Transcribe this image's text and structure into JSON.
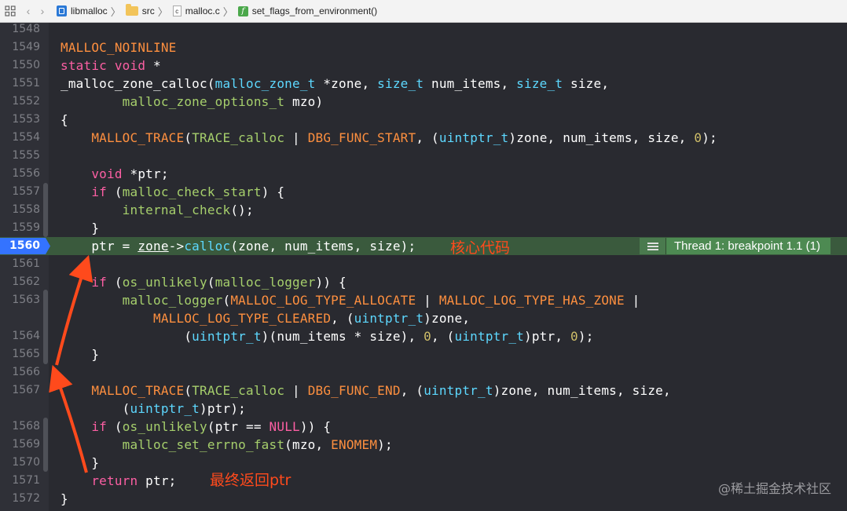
{
  "breadcrumb": {
    "project": "libmalloc",
    "folder": "src",
    "file": "malloc.c",
    "function": "set_flags_from_environment()"
  },
  "lines": [
    {
      "n": "1548",
      "html": ""
    },
    {
      "n": "1549",
      "html": "<span class=\"m\">MALLOC_NOINLINE</span>"
    },
    {
      "n": "1550",
      "html": "<span class=\"k\">static</span> <span class=\"k\">void</span> *"
    },
    {
      "n": "1551",
      "html": "_malloc_zone_calloc(<span class=\"t\">malloc_zone_t</span> *zone, <span class=\"t\">size_t</span> num_items, <span class=\"t\">size_t</span> size,"
    },
    {
      "n": "1552",
      "html": "        <span class=\"f\">malloc_zone_options_t</span> mzo)"
    },
    {
      "n": "1553",
      "html": "{"
    },
    {
      "n": "1554",
      "html": "    <span class=\"m\">MALLOC_TRACE</span>(<span class=\"f\">TRACE_calloc</span> | <span class=\"m\">DBG_FUNC_START</span>, (<span class=\"t\">uintptr_t</span>)zone, num_items, size, <span class=\"n\">0</span>);"
    },
    {
      "n": "1555",
      "html": ""
    },
    {
      "n": "1556",
      "html": "    <span class=\"k\">void</span> *ptr;"
    },
    {
      "n": "1557",
      "html": "    <span class=\"k\">if</span> (<span class=\"f\">malloc_check_start</span>) {"
    },
    {
      "n": "1558",
      "html": "        <span class=\"f\">internal_check</span>();"
    },
    {
      "n": "1559",
      "html": "    }"
    },
    {
      "n": "1560",
      "html": "    ptr = <span class=\"u\">zone</span>-><span class=\"t\">calloc</span>(zone, num_items, size);",
      "breakpoint": true
    },
    {
      "n": "1561",
      "html": ""
    },
    {
      "n": "1562",
      "html": "    <span class=\"k\">if</span> (<span class=\"f\">os_unlikely</span>(<span class=\"f\">malloc_logger</span>)) {"
    },
    {
      "n": "1563",
      "html": "        <span class=\"f\">malloc_logger</span>(<span class=\"m\">MALLOC_LOG_TYPE_ALLOCATE</span> | <span class=\"m\">MALLOC_LOG_TYPE_HAS_ZONE</span> |"
    },
    {
      "n": "",
      "html": "            <span class=\"m\">MALLOC_LOG_TYPE_CLEARED</span>, (<span class=\"t\">uintptr_t</span>)zone,"
    },
    {
      "n": "1564",
      "html": "                (<span class=\"t\">uintptr_t</span>)(num_items * size), <span class=\"n\">0</span>, (<span class=\"t\">uintptr_t</span>)ptr, <span class=\"n\">0</span>);"
    },
    {
      "n": "1565",
      "html": "    }"
    },
    {
      "n": "1566",
      "html": ""
    },
    {
      "n": "1567",
      "html": "    <span class=\"m\">MALLOC_TRACE</span>(<span class=\"f\">TRACE_calloc</span> | <span class=\"m\">DBG_FUNC_END</span>, (<span class=\"t\">uintptr_t</span>)zone, num_items, size,"
    },
    {
      "n": "",
      "html": "        (<span class=\"t\">uintptr_t</span>)ptr);"
    },
    {
      "n": "1568",
      "html": "    <span class=\"k\">if</span> (<span class=\"f\">os_unlikely</span>(ptr == <span class=\"k\">NULL</span>)) {"
    },
    {
      "n": "1569",
      "html": "        <span class=\"f\">malloc_set_errno_fast</span>(mzo, <span class=\"m\">ENOMEM</span>);"
    },
    {
      "n": "1570",
      "html": "    }"
    },
    {
      "n": "1571",
      "html": "    <span class=\"k\">return</span> ptr;"
    },
    {
      "n": "1572",
      "html": "}"
    }
  ],
  "breakpoint_badge": "Thread 1: breakpoint 1.1 (1)",
  "annotations": {
    "core_code": "核心代码",
    "final_return": "最终返回ptr",
    "color": "#ff4a1c"
  },
  "watermark": "@稀土掘金技术社区",
  "colors": {
    "keyword": "#fc5fa3",
    "type": "#5dd8ff",
    "function": "#a6cf6c",
    "macro": "#fd8f3f",
    "number": "#d0bf69",
    "background": "#292a30",
    "breakpoint": "#3473ff",
    "current_line": "#3a5a3d"
  }
}
